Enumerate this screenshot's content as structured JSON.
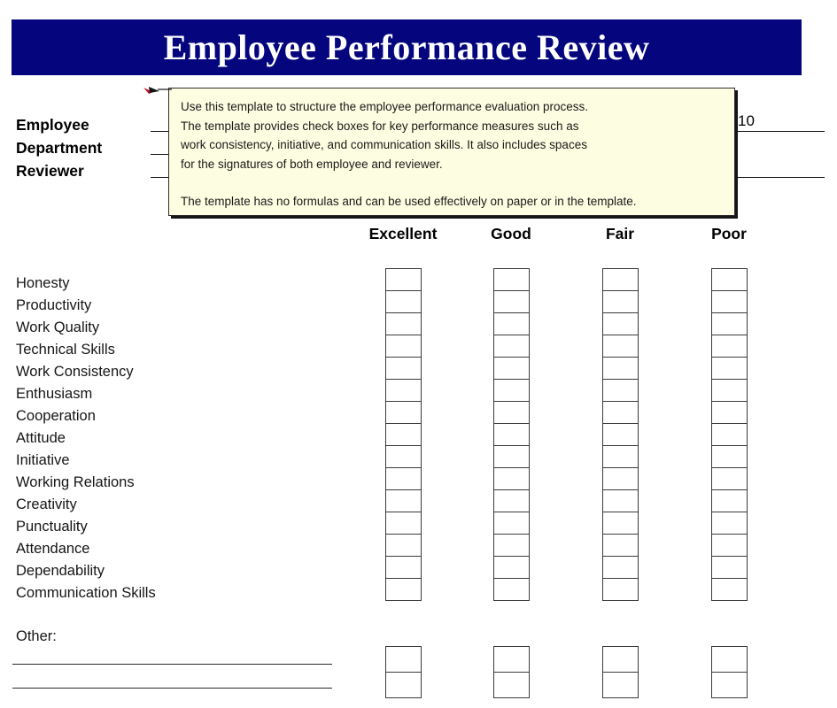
{
  "document": {
    "title": "Employee Performance Review",
    "banner_color": "#05057d",
    "title_color": "#ffffff"
  },
  "identity_fields": [
    {
      "label": "Employee",
      "value": ""
    },
    {
      "label": "Department",
      "value": ""
    },
    {
      "label": "Reviewer",
      "value": ""
    }
  ],
  "date_field": {
    "value": "10"
  },
  "comment": {
    "icon": "comment-pointer-icon",
    "background_color": "#fdfde1",
    "lines": [
      "Use this template to structure the employee performance evaluation process.",
      "The template provides check boxes for key performance measures such as",
      "work consistency, initiative, and communication skills. It also includes spaces",
      "for the signatures of both employee and reviewer."
    ],
    "closing_line": "The template has no formulas and can be used effectively on paper or in the template."
  },
  "rating_columns": [
    {
      "label": "Excellent"
    },
    {
      "label": "Good"
    },
    {
      "label": "Fair"
    },
    {
      "label": "Poor"
    }
  ],
  "criteria": [
    {
      "label": "Honesty"
    },
    {
      "label": "Productivity"
    },
    {
      "label": "Work Quality"
    },
    {
      "label": "Technical Skills"
    },
    {
      "label": "Work Consistency"
    },
    {
      "label": "Enthusiasm"
    },
    {
      "label": "Cooperation"
    },
    {
      "label": "Attitude"
    },
    {
      "label": "Initiative"
    },
    {
      "label": "Working Relations"
    },
    {
      "label": "Creativity"
    },
    {
      "label": "Punctuality"
    },
    {
      "label": "Attendance"
    },
    {
      "label": "Dependability"
    },
    {
      "label": "Communication Skills"
    }
  ],
  "other_section": {
    "label": "Other:",
    "blank_lines": 2,
    "extra_rating_rows": 2
  }
}
